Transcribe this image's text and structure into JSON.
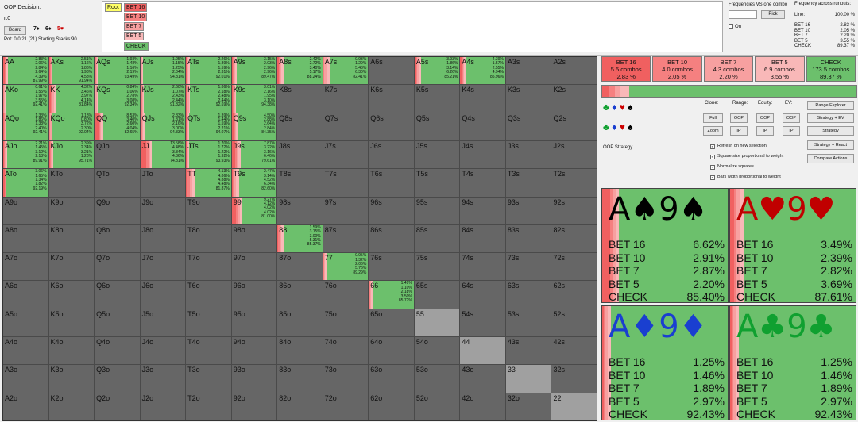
{
  "header": {
    "decision": "OOP Decision:",
    "path": "r:0",
    "board_button": "Board",
    "board_cards": [
      {
        "t": "7♠",
        "c": "#000"
      },
      {
        "t": "6♠",
        "c": "#000"
      },
      {
        "t": "5♥",
        "c": "#c00"
      }
    ],
    "pot": "Pot: 0 0 21 (21) Starting Stacks:90"
  },
  "tree": [
    {
      "label": "Root",
      "bg": "#ffff66"
    },
    {
      "label": "BET 16",
      "bg": "#f06060"
    },
    {
      "label": "BET 10",
      "bg": "#f58080"
    },
    {
      "label": "BET 7",
      "bg": "#f7a0a0"
    },
    {
      "label": "BET 5",
      "bg": "#f9b8b8"
    },
    {
      "label": "CHECK",
      "bg": "#6cc06c"
    }
  ],
  "freq_panel": {
    "title1": "Frequencies VS one combo",
    "title2": "Frequency across runouts:",
    "pick_label": "Pick",
    "on_label": "On",
    "line_label": "Line:",
    "line_value": "100.00 %",
    "rows": [
      {
        "k": "BET 16",
        "v": "2.83 %"
      },
      {
        "k": "BET 10",
        "v": "2.05 %"
      },
      {
        "k": "BET 7",
        "v": "2.20 %"
      },
      {
        "k": "BET 5",
        "v": "3.55 %"
      },
      {
        "k": "CHECK",
        "v": "89.37 %"
      }
    ]
  },
  "grid": [
    {
      "h": "AA",
      "f": [
        0.0283,
        0.0206,
        0.0284,
        0.0264,
        0.9799
      ],
      "s": "2.83%\n2.06%\n2.84%\n2.64%\n4.39%\n87.99%"
    },
    {
      "h": "AKs",
      "f": [
        0.0251,
        0.0116,
        0.0186,
        0.0198,
        0.9194
      ],
      "s": "2.51%\n1.16%\n1.86%\n1.98%\n4.58%\n91.94%"
    },
    {
      "h": "AQs",
      "f": [
        0.0193,
        0.0148,
        0.0116,
        0.0219,
        0.9349
      ],
      "s": "1.93%\n1.48%\n1.16%\n2.19%\n93.49%"
    },
    {
      "h": "AJs",
      "f": [
        0.0105,
        0.0115,
        0.0125,
        0.0204,
        0.9481
      ],
      "s": "1.05%\n1.15%\n1.25%\n2.04%\n94.81%"
    },
    {
      "h": "ATs",
      "f": [
        0.0226,
        0.0189,
        0.0159,
        0.0231,
        0.9201
      ],
      "s": "2.26%\n1.89%\n1.59%\n2.31%\n92.01%"
    },
    {
      "h": "A9s",
      "f": [
        0.0315,
        0.0203,
        0.0296,
        0.0296,
        0.8947
      ],
      "s": "3.15%\n2.03%\n2.96%\n2.96%\n89.47%"
    },
    {
      "h": "A8s",
      "f": [
        0.0242,
        0.0272,
        0.034,
        0.0517,
        0.8824
      ],
      "s": "2.42%\n2.72%\n3.40%\n5.17%\n88.24%"
    },
    {
      "h": "A7s",
      "f": [
        0.0093,
        0.0129,
        0.0543,
        0.063,
        0.8241
      ],
      "s": "0.93%\n1.29%\n5.43%\n6.30%\n82.41%"
    },
    {
      "h": "A6s",
      "f": null,
      "s": ""
    },
    {
      "h": "A5s",
      "f": [
        0.0393,
        0.0186,
        0.0314,
        0.0626,
        0.8521
      ],
      "s": "3.93%\n1.86%\n3.14%\n6.26%\n85.21%"
    },
    {
      "h": "A4s",
      "f": [
        0.0439,
        0.0157,
        0.0255,
        0.0494,
        0.8596
      ],
      "s": "4.39%\n1.57%\n2.55%\n4.94%\n85.96%"
    },
    {
      "h": "A3s",
      "f": null,
      "s": ""
    },
    {
      "h": "A2s",
      "f": null,
      "s": ""
    },
    {
      "h": "AKo",
      "f": [
        0.0061,
        0.0155,
        0.0197,
        0.0355,
        0.9241
      ],
      "s": "0.61%\n1.55%\n1.97%\n3.55%\n92.41%"
    },
    {
      "h": "KK",
      "f": [
        0.0432,
        0.0346,
        0.0397,
        0.0414,
        0.8184
      ],
      "s": "4.32%\n3.46%\n3.97%\n4.14%\n81.84%"
    },
    {
      "h": "KQs",
      "f": [
        0.0084,
        0.0106,
        0.0278,
        0.0308,
        0.9234
      ],
      "s": "0.84%\n1.06%\n2.78%\n3.08%\n92.34%"
    },
    {
      "h": "KJs",
      "f": [
        0.026,
        0.0107,
        0.0243,
        0.0244,
        0.9182
      ],
      "s": "2.60%\n1.07%\n2.43%\n2.44%\n91.82%"
    },
    {
      "h": "KTs",
      "f": [
        0.0186,
        0.0218,
        0.0248,
        0.0244,
        0.9269
      ],
      "s": "1.86%\n2.18%\n2.48%\n2.44%\n92.69%"
    },
    {
      "h": "K9s",
      "f": [
        0.0301,
        0.0216,
        0.0195,
        0.031,
        0.9438
      ],
      "s": "3.01%\n2.16%\n1.95%\n3.10%\n94.38%"
    },
    {
      "h": "K8s",
      "f": null,
      "s": ""
    },
    {
      "h": "K7s",
      "f": null,
      "s": ""
    },
    {
      "h": "K6s",
      "f": null,
      "s": ""
    },
    {
      "h": "K5s",
      "f": null,
      "s": ""
    },
    {
      "h": "K4s",
      "f": null,
      "s": ""
    },
    {
      "h": "K3s",
      "f": null,
      "s": ""
    },
    {
      "h": "K2s",
      "f": null,
      "s": ""
    },
    {
      "h": "AQo",
      "f": [
        0.0133,
        0.0186,
        0.0138,
        0.024,
        0.9241
      ],
      "s": "1.33%\n1.86%\n1.38%\n2.40%\n92.41%"
    },
    {
      "h": "KQo",
      "f": [
        0.0118,
        0.008,
        0.0372,
        0.023,
        0.9204
      ],
      "s": "1.18%\n0.80%\n3.72%\n2.30%\n92.04%"
    },
    {
      "h": "QQ",
      "f": [
        0.0853,
        0.034,
        0.026,
        0.0404,
        0.8265
      ],
      "s": "8.53%\n3.40%\n2.60%\n4.04%\n82.65%"
    },
    {
      "h": "QJs",
      "f": [
        0.0283,
        0.0131,
        0.0216,
        0.03,
        0.9433
      ],
      "s": "2.83%\n1.31%\n2.16%\n3.00%\n94.33%"
    },
    {
      "h": "QTs",
      "f": [
        0.0139,
        0.0144,
        0.0159,
        0.0221,
        0.9407
      ],
      "s": "1.39%\n1.44%\n1.59%\n2.21%\n94.07%"
    },
    {
      "h": "Q9s",
      "f": [
        0.045,
        0.0288,
        0.0264,
        0.0284,
        0.8435
      ],
      "s": "4.50%\n2.88%\n2.64%\n2.84%\n84.35%"
    },
    {
      "h": "Q8s",
      "f": null,
      "s": ""
    },
    {
      "h": "Q7s",
      "f": null,
      "s": ""
    },
    {
      "h": "Q6s",
      "f": null,
      "s": ""
    },
    {
      "h": "Q5s",
      "f": null,
      "s": ""
    },
    {
      "h": "Q4s",
      "f": null,
      "s": ""
    },
    {
      "h": "Q3s",
      "f": null,
      "s": ""
    },
    {
      "h": "Q2s",
      "f": null,
      "s": ""
    },
    {
      "h": "AJo",
      "f": [
        0.0221,
        0.0145,
        0.0312,
        0.0213,
        0.8991
      ],
      "s": "2.21%\n1.45%\n3.12%\n2.13%\n89.91%"
    },
    {
      "h": "KJo",
      "f": [
        0.0239,
        0.0234,
        0.0321,
        0.0128,
        0.9571
      ],
      "s": "2.39%\n2.34%\n3.21%\n1.28%\n95.71%"
    },
    {
      "h": "QJo",
      "f": null,
      "s": ""
    },
    {
      "h": "JJ",
      "f": [
        0.1358,
        0.0448,
        0.0384,
        0.0436,
        0.7481
      ],
      "s": "13.58%\n4.48%\n3.84%\n4.36%\n74.81%"
    },
    {
      "h": "JTs",
      "f": [
        0.017,
        0.0172,
        0.0122,
        0.0192,
        0.9393
      ],
      "s": "1.70%\n1.72%\n1.22%\n1.92%\n93.93%"
    },
    {
      "h": "J9s",
      "f": [
        0.0787,
        0.0322,
        0.0316,
        0.0646,
        0.7961
      ],
      "s": "7.87%\n3.22%\n3.16%\n6.46%\n79.61%"
    },
    {
      "h": "J8s",
      "f": null,
      "s": ""
    },
    {
      "h": "J7s",
      "f": null,
      "s": ""
    },
    {
      "h": "J6s",
      "f": null,
      "s": ""
    },
    {
      "h": "J5s",
      "f": null,
      "s": ""
    },
    {
      "h": "J4s",
      "f": null,
      "s": ""
    },
    {
      "h": "J3s",
      "f": null,
      "s": ""
    },
    {
      "h": "J2s",
      "f": null,
      "s": ""
    },
    {
      "h": "ATo",
      "f": [
        0.0306,
        0.0165,
        0.0134,
        0.0182,
        0.9219
      ],
      "s": "3.06%\n1.65%\n1.34%\n1.82%\n92.19%"
    },
    {
      "h": "KTo",
      "f": null,
      "s": ""
    },
    {
      "h": "QTo",
      "f": null,
      "s": ""
    },
    {
      "h": "JTo",
      "f": null,
      "s": ""
    },
    {
      "h": "TT",
      "f": [
        0.0413,
        0.0486,
        0.0488,
        0.0448,
        0.8187
      ],
      "s": "4.13%\n4.86%\n4.88%\n4.48%\n81.87%"
    },
    {
      "h": "T9s",
      "f": [
        0.0247,
        0.0314,
        0.0452,
        0.0634,
        0.826
      ],
      "s": "2.47%\n3.14%\n4.52%\n6.34%\n82.60%"
    },
    {
      "h": "T8s",
      "f": null,
      "s": ""
    },
    {
      "h": "T7s",
      "f": null,
      "s": ""
    },
    {
      "h": "T6s",
      "f": null,
      "s": ""
    },
    {
      "h": "T5s",
      "f": null,
      "s": ""
    },
    {
      "h": "T4s",
      "f": null,
      "s": ""
    },
    {
      "h": "T3s",
      "f": null,
      "s": ""
    },
    {
      "h": "T2s",
      "f": null,
      "s": ""
    },
    {
      "h": "A9o",
      "f": null,
      "s": ""
    },
    {
      "h": "K9o",
      "f": null,
      "s": ""
    },
    {
      "h": "Q9o",
      "f": null,
      "s": ""
    },
    {
      "h": "J9o",
      "f": null,
      "s": ""
    },
    {
      "h": "T9o",
      "f": null,
      "s": ""
    },
    {
      "h": "99",
      "f": [
        0.0927,
        0.0412,
        0.0402,
        0.0402,
        0.81
      ],
      "s": "9.27%\n4.12%\n4.02%\n4.02%\n81.00%"
    },
    {
      "h": "98s",
      "f": null,
      "s": ""
    },
    {
      "h": "97s",
      "f": null,
      "s": ""
    },
    {
      "h": "96s",
      "f": null,
      "s": ""
    },
    {
      "h": "95s",
      "f": null,
      "s": ""
    },
    {
      "h": "94s",
      "f": null,
      "s": ""
    },
    {
      "h": "93s",
      "f": null,
      "s": ""
    },
    {
      "h": "92s",
      "f": null,
      "s": ""
    },
    {
      "h": "A8o",
      "f": null,
      "s": ""
    },
    {
      "h": "K8o",
      "f": null,
      "s": ""
    },
    {
      "h": "Q8o",
      "f": null,
      "s": ""
    },
    {
      "h": "J8o",
      "f": null,
      "s": ""
    },
    {
      "h": "T8o",
      "f": null,
      "s": ""
    },
    {
      "h": "98o",
      "f": null,
      "s": ""
    },
    {
      "h": "88",
      "f": [
        0.0159,
        0.0315,
        0.03,
        0.0531,
        0.8537
      ],
      "s": "1.59%\n3.15%\n3.00%\n5.31%\n85.37%"
    },
    {
      "h": "87s",
      "f": null,
      "s": ""
    },
    {
      "h": "86s",
      "f": null,
      "s": ""
    },
    {
      "h": "85s",
      "f": null,
      "s": ""
    },
    {
      "h": "84s",
      "f": null,
      "s": ""
    },
    {
      "h": "83s",
      "f": null,
      "s": ""
    },
    {
      "h": "82s",
      "f": null,
      "s": ""
    },
    {
      "h": "A7o",
      "f": null,
      "s": ""
    },
    {
      "h": "K7o",
      "f": null,
      "s": ""
    },
    {
      "h": "Q7o",
      "f": null,
      "s": ""
    },
    {
      "h": "J7o",
      "f": null,
      "s": ""
    },
    {
      "h": "T7o",
      "f": null,
      "s": ""
    },
    {
      "h": "97o",
      "f": null,
      "s": ""
    },
    {
      "h": "87o",
      "f": null,
      "s": ""
    },
    {
      "h": "77",
      "f": [
        0.0095,
        0.0132,
        0.0206,
        0.0576,
        0.8929
      ],
      "s": "0.95%\n1.32%\n2.06%\n5.76%\n89.29%"
    },
    {
      "h": "76s",
      "f": null,
      "s": ""
    },
    {
      "h": "75s",
      "f": null,
      "s": ""
    },
    {
      "h": "74s",
      "f": null,
      "s": ""
    },
    {
      "h": "73s",
      "f": null,
      "s": ""
    },
    {
      "h": "72s",
      "f": null,
      "s": ""
    },
    {
      "h": "A6o",
      "f": null,
      "s": ""
    },
    {
      "h": "K6o",
      "f": null,
      "s": ""
    },
    {
      "h": "Q6o",
      "f": null,
      "s": ""
    },
    {
      "h": "J6o",
      "f": null,
      "s": ""
    },
    {
      "h": "T6o",
      "f": null,
      "s": ""
    },
    {
      "h": "96o",
      "f": null,
      "s": ""
    },
    {
      "h": "86o",
      "f": null,
      "s": ""
    },
    {
      "h": "76o",
      "f": null,
      "s": ""
    },
    {
      "h": "66",
      "f": [
        0.0149,
        0.011,
        0.0218,
        0.035,
        0.8572
      ],
      "s": "1.49%\n1.10%\n2.18%\n3.50%\n85.72%"
    },
    {
      "h": "65s",
      "f": null,
      "s": ""
    },
    {
      "h": "64s",
      "f": null,
      "s": ""
    },
    {
      "h": "63s",
      "f": null,
      "s": ""
    },
    {
      "h": "62s",
      "f": null,
      "s": ""
    },
    {
      "h": "A5o",
      "f": null,
      "s": ""
    },
    {
      "h": "K5o",
      "f": null,
      "s": ""
    },
    {
      "h": "Q5o",
      "f": null,
      "s": ""
    },
    {
      "h": "J5o",
      "f": null,
      "s": ""
    },
    {
      "h": "T5o",
      "f": null,
      "s": ""
    },
    {
      "h": "95o",
      "f": null,
      "s": ""
    },
    {
      "h": "85o",
      "f": null,
      "s": ""
    },
    {
      "h": "75o",
      "f": null,
      "s": ""
    },
    {
      "h": "65o",
      "f": null,
      "s": ""
    },
    {
      "h": "55",
      "f": null,
      "s": "",
      "bg": "#a0a0a0"
    },
    {
      "h": "54s",
      "f": null,
      "s": ""
    },
    {
      "h": "53s",
      "f": null,
      "s": ""
    },
    {
      "h": "52s",
      "f": null,
      "s": ""
    },
    {
      "h": "A4o",
      "f": null,
      "s": ""
    },
    {
      "h": "K4o",
      "f": null,
      "s": ""
    },
    {
      "h": "Q4o",
      "f": null,
      "s": ""
    },
    {
      "h": "J4o",
      "f": null,
      "s": ""
    },
    {
      "h": "T4o",
      "f": null,
      "s": ""
    },
    {
      "h": "94o",
      "f": null,
      "s": ""
    },
    {
      "h": "84o",
      "f": null,
      "s": ""
    },
    {
      "h": "74o",
      "f": null,
      "s": ""
    },
    {
      "h": "64o",
      "f": null,
      "s": ""
    },
    {
      "h": "54o",
      "f": null,
      "s": ""
    },
    {
      "h": "44",
      "f": null,
      "s": "",
      "bg": "#a0a0a0"
    },
    {
      "h": "43s",
      "f": null,
      "s": ""
    },
    {
      "h": "42s",
      "f": null,
      "s": ""
    },
    {
      "h": "A3o",
      "f": null,
      "s": ""
    },
    {
      "h": "K3o",
      "f": null,
      "s": ""
    },
    {
      "h": "Q3o",
      "f": null,
      "s": ""
    },
    {
      "h": "J3o",
      "f": null,
      "s": ""
    },
    {
      "h": "T3o",
      "f": null,
      "s": ""
    },
    {
      "h": "93o",
      "f": null,
      "s": ""
    },
    {
      "h": "83o",
      "f": null,
      "s": ""
    },
    {
      "h": "73o",
      "f": null,
      "s": ""
    },
    {
      "h": "63o",
      "f": null,
      "s": ""
    },
    {
      "h": "53o",
      "f": null,
      "s": ""
    },
    {
      "h": "43o",
      "f": null,
      "s": ""
    },
    {
      "h": "33",
      "f": null,
      "s": "",
      "bg": "#a0a0a0"
    },
    {
      "h": "32s",
      "f": null,
      "s": ""
    },
    {
      "h": "A2o",
      "f": null,
      "s": ""
    },
    {
      "h": "K2o",
      "f": null,
      "s": ""
    },
    {
      "h": "Q2o",
      "f": null,
      "s": ""
    },
    {
      "h": "J2o",
      "f": null,
      "s": ""
    },
    {
      "h": "T2o",
      "f": null,
      "s": ""
    },
    {
      "h": "92o",
      "f": null,
      "s": ""
    },
    {
      "h": "82o",
      "f": null,
      "s": ""
    },
    {
      "h": "72o",
      "f": null,
      "s": ""
    },
    {
      "h": "62o",
      "f": null,
      "s": ""
    },
    {
      "h": "52o",
      "f": null,
      "s": ""
    },
    {
      "h": "42o",
      "f": null,
      "s": ""
    },
    {
      "h": "32o",
      "f": null,
      "s": ""
    },
    {
      "h": "22",
      "f": null,
      "s": "",
      "bg": "#a0a0a0"
    }
  ],
  "actions": [
    {
      "name": "BET 16",
      "combos": "5.5 combos",
      "pct": "2.83 %",
      "bg": "#f06060"
    },
    {
      "name": "BET 10",
      "combos": "4.0 combos",
      "pct": "2.05 %",
      "bg": "#f58080"
    },
    {
      "name": "BET 7",
      "combos": "4.3 combos",
      "pct": "2.20 %",
      "bg": "#f7a0a0"
    },
    {
      "name": "BET 5",
      "combos": "6.9 combos",
      "pct": "3.55 %",
      "bg": "#f9b8b8"
    },
    {
      "name": "CHECK",
      "combos": "173.5 combos",
      "pct": "89.37 %",
      "bg": "#6cc06c"
    }
  ],
  "colors": {
    "bet16": "#f06060",
    "bet10": "#f58080",
    "bet7": "#f7a0a0",
    "bet5": "#f9b8b8",
    "check": "#6cc06c",
    "empty": "#666666"
  },
  "controls": {
    "clone": "Clone:",
    "range": "Range:",
    "equity": "Equity:",
    "ev": "EV:",
    "full": "Full",
    "zoom": "Zoom",
    "oop": "OOP",
    "ip": "IP",
    "range_explorer": "Range Explorer",
    "strategy_ev": "Strategy + EV",
    "strategy": "Strategy",
    "strategy_react": "Strategy + React",
    "compare_actions": "Compare Actions",
    "oop_strategy": "OOP Strategy",
    "checks": [
      "Refresh on new selection",
      "Square size proportional to weight",
      "Normalize squares",
      "Bars width proportional to weight"
    ]
  },
  "combos": [
    {
      "title": "A♠9♠",
      "color": "#000000",
      "rows": [
        [
          "BET 16",
          "6.62%"
        ],
        [
          "BET 10",
          "2.91%"
        ],
        [
          "BET 7",
          "2.87%"
        ],
        [
          "BET 5",
          "2.20%"
        ],
        [
          "CHECK",
          "85.40%"
        ]
      ],
      "f": [
        0.0662,
        0.0291,
        0.0287,
        0.022
      ]
    },
    {
      "title": "A♥9♥",
      "color": "#c00000",
      "rows": [
        [
          "BET 16",
          "3.49%"
        ],
        [
          "BET 10",
          "2.39%"
        ],
        [
          "BET 7",
          "2.82%"
        ],
        [
          "BET 5",
          "3.69%"
        ],
        [
          "CHECK",
          "87.61%"
        ]
      ],
      "f": [
        0.0349,
        0.0239,
        0.0282,
        0.0369
      ]
    },
    {
      "title": "A♦9♦",
      "color": "#1a3fd0",
      "rows": [
        [
          "BET 16",
          "1.25%"
        ],
        [
          "BET 10",
          "1.46%"
        ],
        [
          "BET 7",
          "1.89%"
        ],
        [
          "BET 5",
          "2.97%"
        ],
        [
          "CHECK",
          "92.43%"
        ]
      ],
      "f": [
        0.0125,
        0.0146,
        0.0189,
        0.0297
      ]
    },
    {
      "title": "A♣9♣",
      "color": "#10a030",
      "rows": [
        [
          "BET 16",
          "1.25%"
        ],
        [
          "BET 10",
          "1.46%"
        ],
        [
          "BET 7",
          "1.89%"
        ],
        [
          "BET 5",
          "2.97%"
        ],
        [
          "CHECK",
          "92.43%"
        ]
      ],
      "f": [
        0.0125,
        0.0146,
        0.0189,
        0.0297
      ]
    }
  ]
}
